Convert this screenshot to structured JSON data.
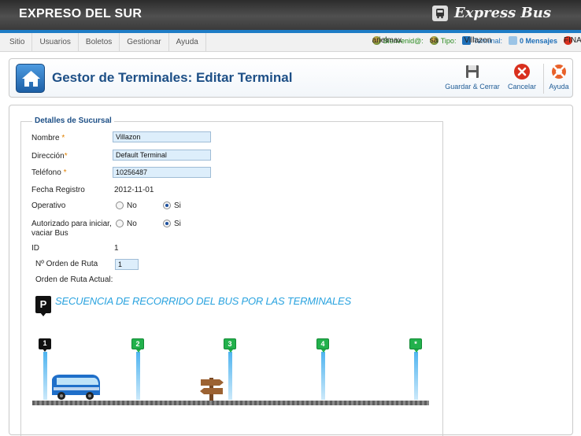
{
  "header": {
    "app_title": "EXPRESO DEL SUR",
    "brand": "Express Bus"
  },
  "menu": {
    "items": [
      "Sitio",
      "Usuarios",
      "Boletos",
      "Gestionar",
      "Ayuda"
    ]
  },
  "status": {
    "welcome_label": "Bienvenid@:",
    "username": "arielmax",
    "type_label": "Tipo:",
    "type_value": "sa",
    "terminal_label": "Terminal:",
    "terminal_value": "Villazon",
    "messages": "0 Mensajes",
    "logout": "FINALIZAR"
  },
  "title": {
    "text": "Gestor de Terminales: Editar Terminal"
  },
  "toolbar": {
    "save_close": "Guardar & Cerrar",
    "cancel": "Cancelar",
    "help": "Ayuda"
  },
  "form": {
    "legend": "Detalles de Sucursal",
    "nombre_label": "Nombre",
    "nombre_value": "Villazon",
    "direccion_label": "Dirección",
    "direccion_value": "Default Terminal",
    "telefono_label": "Teléfono",
    "telefono_value": "10256487",
    "fecha_label": "Fecha Registro",
    "fecha_value": "2012-11-01",
    "operativo_label": "Operativo",
    "autorizado_label_1": "Autorizado para iniciar,",
    "autorizado_label_2": "vaciar Bus",
    "no_label": "No",
    "si_label": "Si",
    "operativo_selected": "Si",
    "autorizado_selected": "Si",
    "id_label": "ID",
    "id_value": "1",
    "orden_label": "Nº Orden de Ruta",
    "orden_value": "1",
    "orden_actual_label": "Orden de Ruta Actual:",
    "required_mark": "*"
  },
  "route": {
    "parking_marker": "P",
    "title": "SECUENCIA DE RECORRIDO DEL BUS POR LAS TERMINALES",
    "stops": [
      "1",
      "2",
      "3",
      "4",
      "*"
    ]
  },
  "colors": {
    "accent_blue": "#1e7cc6",
    "title_blue": "#1d4f86",
    "stop_green": "#22b14c",
    "route_title": "#2aa3df"
  }
}
